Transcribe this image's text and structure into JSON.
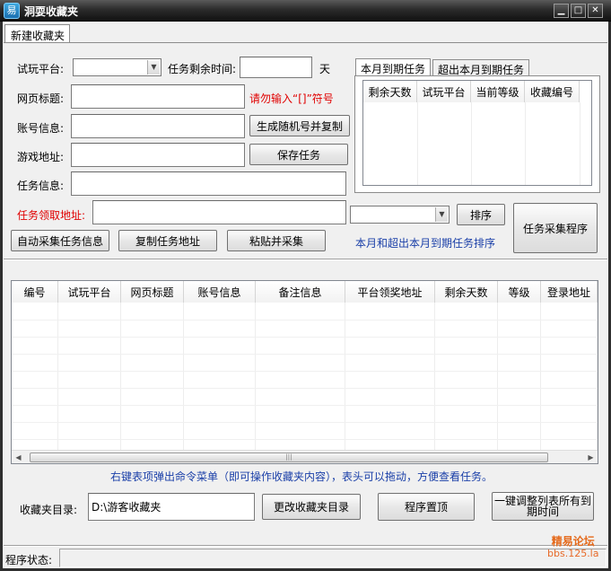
{
  "window": {
    "title": "洞耍收藏夹",
    "icon": "app-icon"
  },
  "tabs": {
    "new_folder": "新建收藏夹"
  },
  "form": {
    "platform_label": "试玩平台:",
    "platform_value": "",
    "remaining_label": "任务剩余时间:",
    "remaining_value": "",
    "remaining_unit": "天",
    "webtitle_label": "网页标题:",
    "webtitle_value": "",
    "webtitle_hint": "请勿输入“[]”符号",
    "account_label": "账号信息:",
    "account_value": "",
    "gen_account_button": "生成随机号并复制",
    "game_label": "游戏地址:",
    "game_value": "",
    "save_button": "保存任务",
    "taskinfo_label": "任务信息:",
    "taskinfo_value": "",
    "claim_label": "任务领取地址:",
    "claim_value": "",
    "sort_select_value": "",
    "sort_button": "排序",
    "auto_collect_button": "自动采集任务信息",
    "copy_addr_button": "复制任务地址",
    "paste_collect_button": "粘贴并采集",
    "sort_hint": "本月和超出本月到期任务排序",
    "collector_button": "任务采集程序"
  },
  "expiry": {
    "tab_this_month": "本月到期任务",
    "tab_beyond": "超出本月到期任务",
    "columns": [
      "剩余天数",
      "试玩平台",
      "当前等级",
      "收藏编号"
    ]
  },
  "main_list": {
    "columns": [
      "编号",
      "试玩平台",
      "网页标题",
      "账号信息",
      "备注信息",
      "平台领奖地址",
      "剩余天数",
      "等级",
      "登录地址"
    ],
    "rows": [],
    "hint": "右键表项弹出命令菜单（即可操作收藏夹内容），表头可以拖动，方便查看任务。"
  },
  "bottom": {
    "folder_label": "收藏夹目录:",
    "folder_value": "D:\\游客收藏夹",
    "change_folder_button": "更改收藏夹目录",
    "pin_button": "程序置顶",
    "adjust_button_line1": "一键调整列表所有到",
    "adjust_button_line2": "期时间"
  },
  "status": {
    "label": "程序状态:",
    "value": ""
  },
  "watermark": {
    "line1": "精易论坛",
    "line2": "bbs.125.la"
  }
}
